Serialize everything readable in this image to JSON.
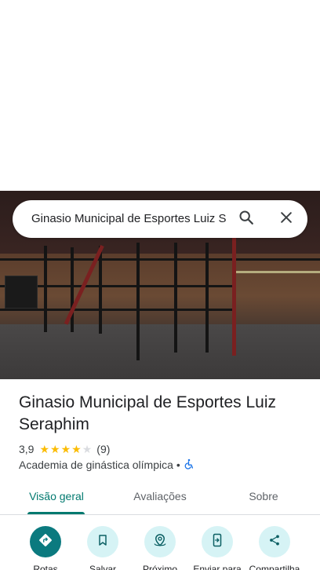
{
  "search": {
    "query": "Ginasio Municipal de Esportes Luiz Seraphim",
    "search_icon": "search-icon",
    "close_icon": "close-icon"
  },
  "place": {
    "name": "Ginasio Municipal de Esportes Luiz Seraphim",
    "rating": "3,9",
    "rating_value": 3.9,
    "stars_filled": 4,
    "stars_total": 5,
    "review_count": "(9)",
    "category": "Academia de ginástica olímpica",
    "separator": "•",
    "accessibility_icon": "wheelchair-icon"
  },
  "tabs": [
    {
      "label": "Visão geral",
      "active": true
    },
    {
      "label": "Avaliações",
      "active": false
    },
    {
      "label": "Sobre",
      "active": false
    }
  ],
  "actions": [
    {
      "label": "Rotas",
      "icon": "directions-icon"
    },
    {
      "label": "Salvar",
      "icon": "bookmark-icon"
    },
    {
      "label": "Próximo",
      "icon": "nearby-icon"
    },
    {
      "label": "Enviar para",
      "icon": "send-to-phone-icon"
    },
    {
      "label": "Compartilha",
      "icon": "share-icon"
    }
  ],
  "colors": {
    "accent": "#01796f",
    "primary_button": "#0b7a7f",
    "secondary_button": "#d6f3f5",
    "star": "#fbbc04",
    "accessibility_icon": "#1a73e8"
  }
}
